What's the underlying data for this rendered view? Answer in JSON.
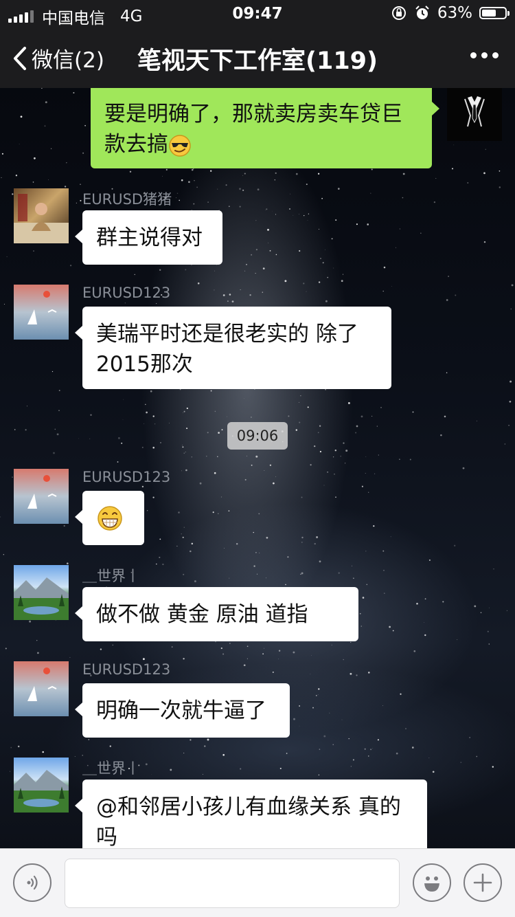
{
  "status_bar": {
    "carrier": "中国电信",
    "network": "4G",
    "time": "09:47",
    "battery": "63%",
    "battery_level": 0.63
  },
  "nav": {
    "back_label": "微信(2)",
    "title": "笔视天下工作室(119)"
  },
  "messages": [
    {
      "type": "outgoing",
      "text": "要是明确了，那就卖房卖车贷巨款去搞",
      "emoji": "sunglasses-emoji"
    },
    {
      "type": "incoming",
      "sender": "EURUSD猪猪",
      "text": "群主说得对"
    },
    {
      "type": "incoming",
      "sender": "EURUSD123",
      "text": "美瑞平时还是很老实的  除了2015那次"
    },
    {
      "type": "time",
      "text": "09:06"
    },
    {
      "type": "incoming",
      "sender": "EURUSD123",
      "emoji": "grin-emoji"
    },
    {
      "type": "incoming",
      "sender": "＿世界丨",
      "text": "做不做  黄金   原油   道指"
    },
    {
      "type": "incoming",
      "sender": "EURUSD123",
      "text": "明确一次就牛逼了"
    },
    {
      "type": "incoming",
      "sender": "＿世界丨",
      "text": "@和邻居小孩儿有血缘关系 真的吗"
    }
  ],
  "input": {
    "value": "",
    "voice_icon": "voice-icon",
    "emoji_icon": "emoji-icon",
    "plus_icon": "plus-icon"
  },
  "colors": {
    "bar_bg": "#1c1c1e",
    "outgoing_bubble": "#a0e75a",
    "incoming_bubble": "#ffffff",
    "input_bar_bg": "#f4f4f6"
  }
}
